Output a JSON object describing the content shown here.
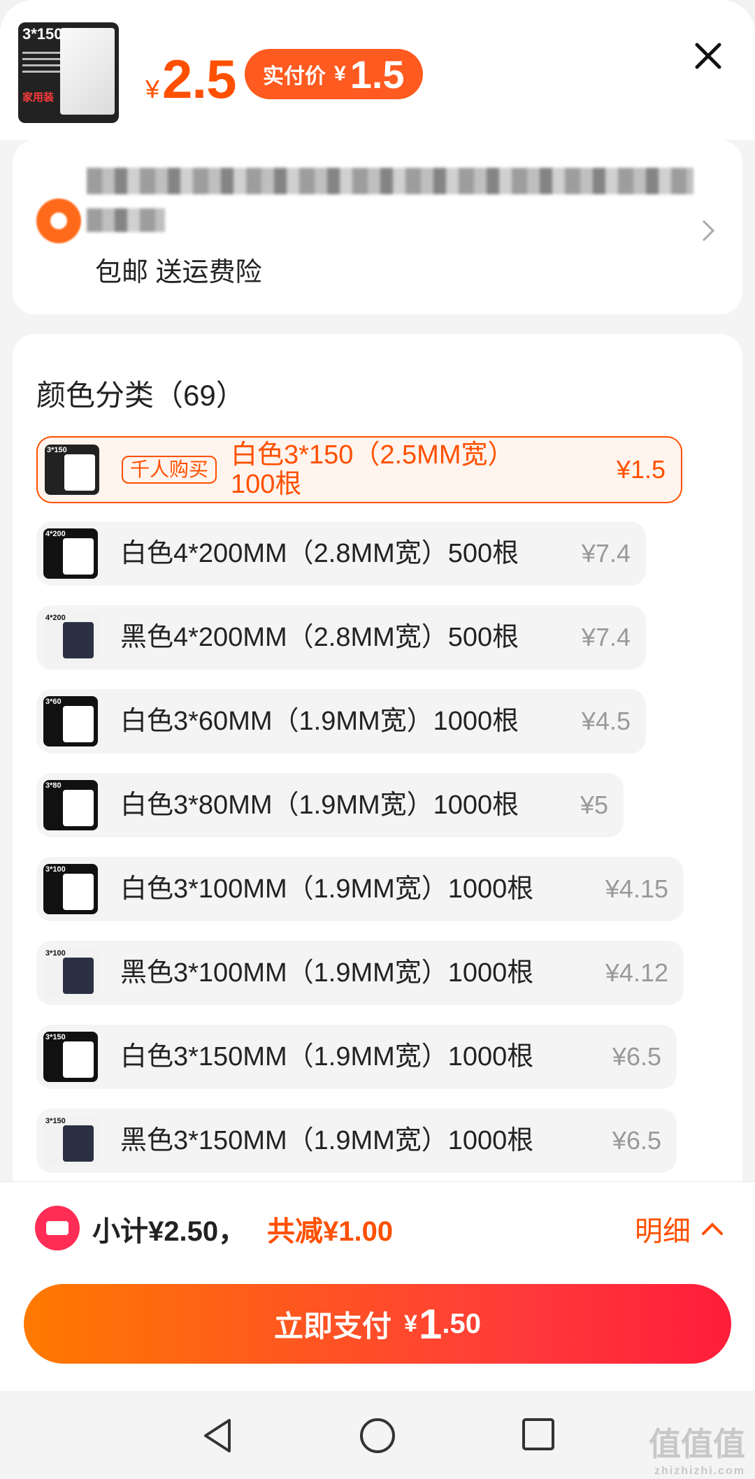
{
  "header": {
    "thumbnail_text": "3*150",
    "thumbnail_badge": "家用装",
    "price_symbol": "¥",
    "price": "2.5",
    "pay_badge_label": "实付价",
    "pay_badge_symbol": "¥",
    "pay_badge_value": "1.5"
  },
  "address": {
    "shipping_text": "包邮 送运费险"
  },
  "sku": {
    "title": "颜色分类（69）",
    "options": [
      {
        "tag": "千人购买",
        "label": "白色3*150（2.5MM宽）100根",
        "price": "¥1.5",
        "thumb": "3*150",
        "selected": true
      },
      {
        "label": "白色4*200MM（2.8MM宽）500根",
        "price": "¥7.4",
        "thumb": "4*200"
      },
      {
        "label": "黑色4*200MM（2.8MM宽）500根",
        "price": "¥7.4",
        "thumb": "4*200"
      },
      {
        "label": "白色3*60MM（1.9MM宽）1000根",
        "price": "¥4.5",
        "thumb": "3*60"
      },
      {
        "label": "白色3*80MM（1.9MM宽）1000根",
        "price": "¥5",
        "thumb": "3*80"
      },
      {
        "label": "白色3*100MM（1.9MM宽）1000根",
        "price": "¥4.15",
        "thumb": "3*100"
      },
      {
        "label": "黑色3*100MM（1.9MM宽）1000根",
        "price": "¥4.12",
        "thumb": "3*100"
      },
      {
        "label": "白色3*150MM（1.9MM宽）1000根",
        "price": "¥6.5",
        "thumb": "3*150"
      },
      {
        "label": "黑色3*150MM（1.9MM宽）1000根",
        "price": "¥6.5",
        "thumb": "3*150"
      }
    ]
  },
  "footer": {
    "subtotal": "小计¥2.50，",
    "discount": "共减¥1.00",
    "detail_label": "明细",
    "pay_label": "立即支付",
    "pay_symbol": "¥",
    "pay_int": "1",
    "pay_dec": ".50"
  },
  "watermark": {
    "text": "值值值",
    "sub": "zhizhizhi.com"
  },
  "colors": {
    "accent": "#ff5000",
    "pay_gradient_start": "#ff7a00",
    "pay_gradient_end": "#ff1d3a"
  }
}
